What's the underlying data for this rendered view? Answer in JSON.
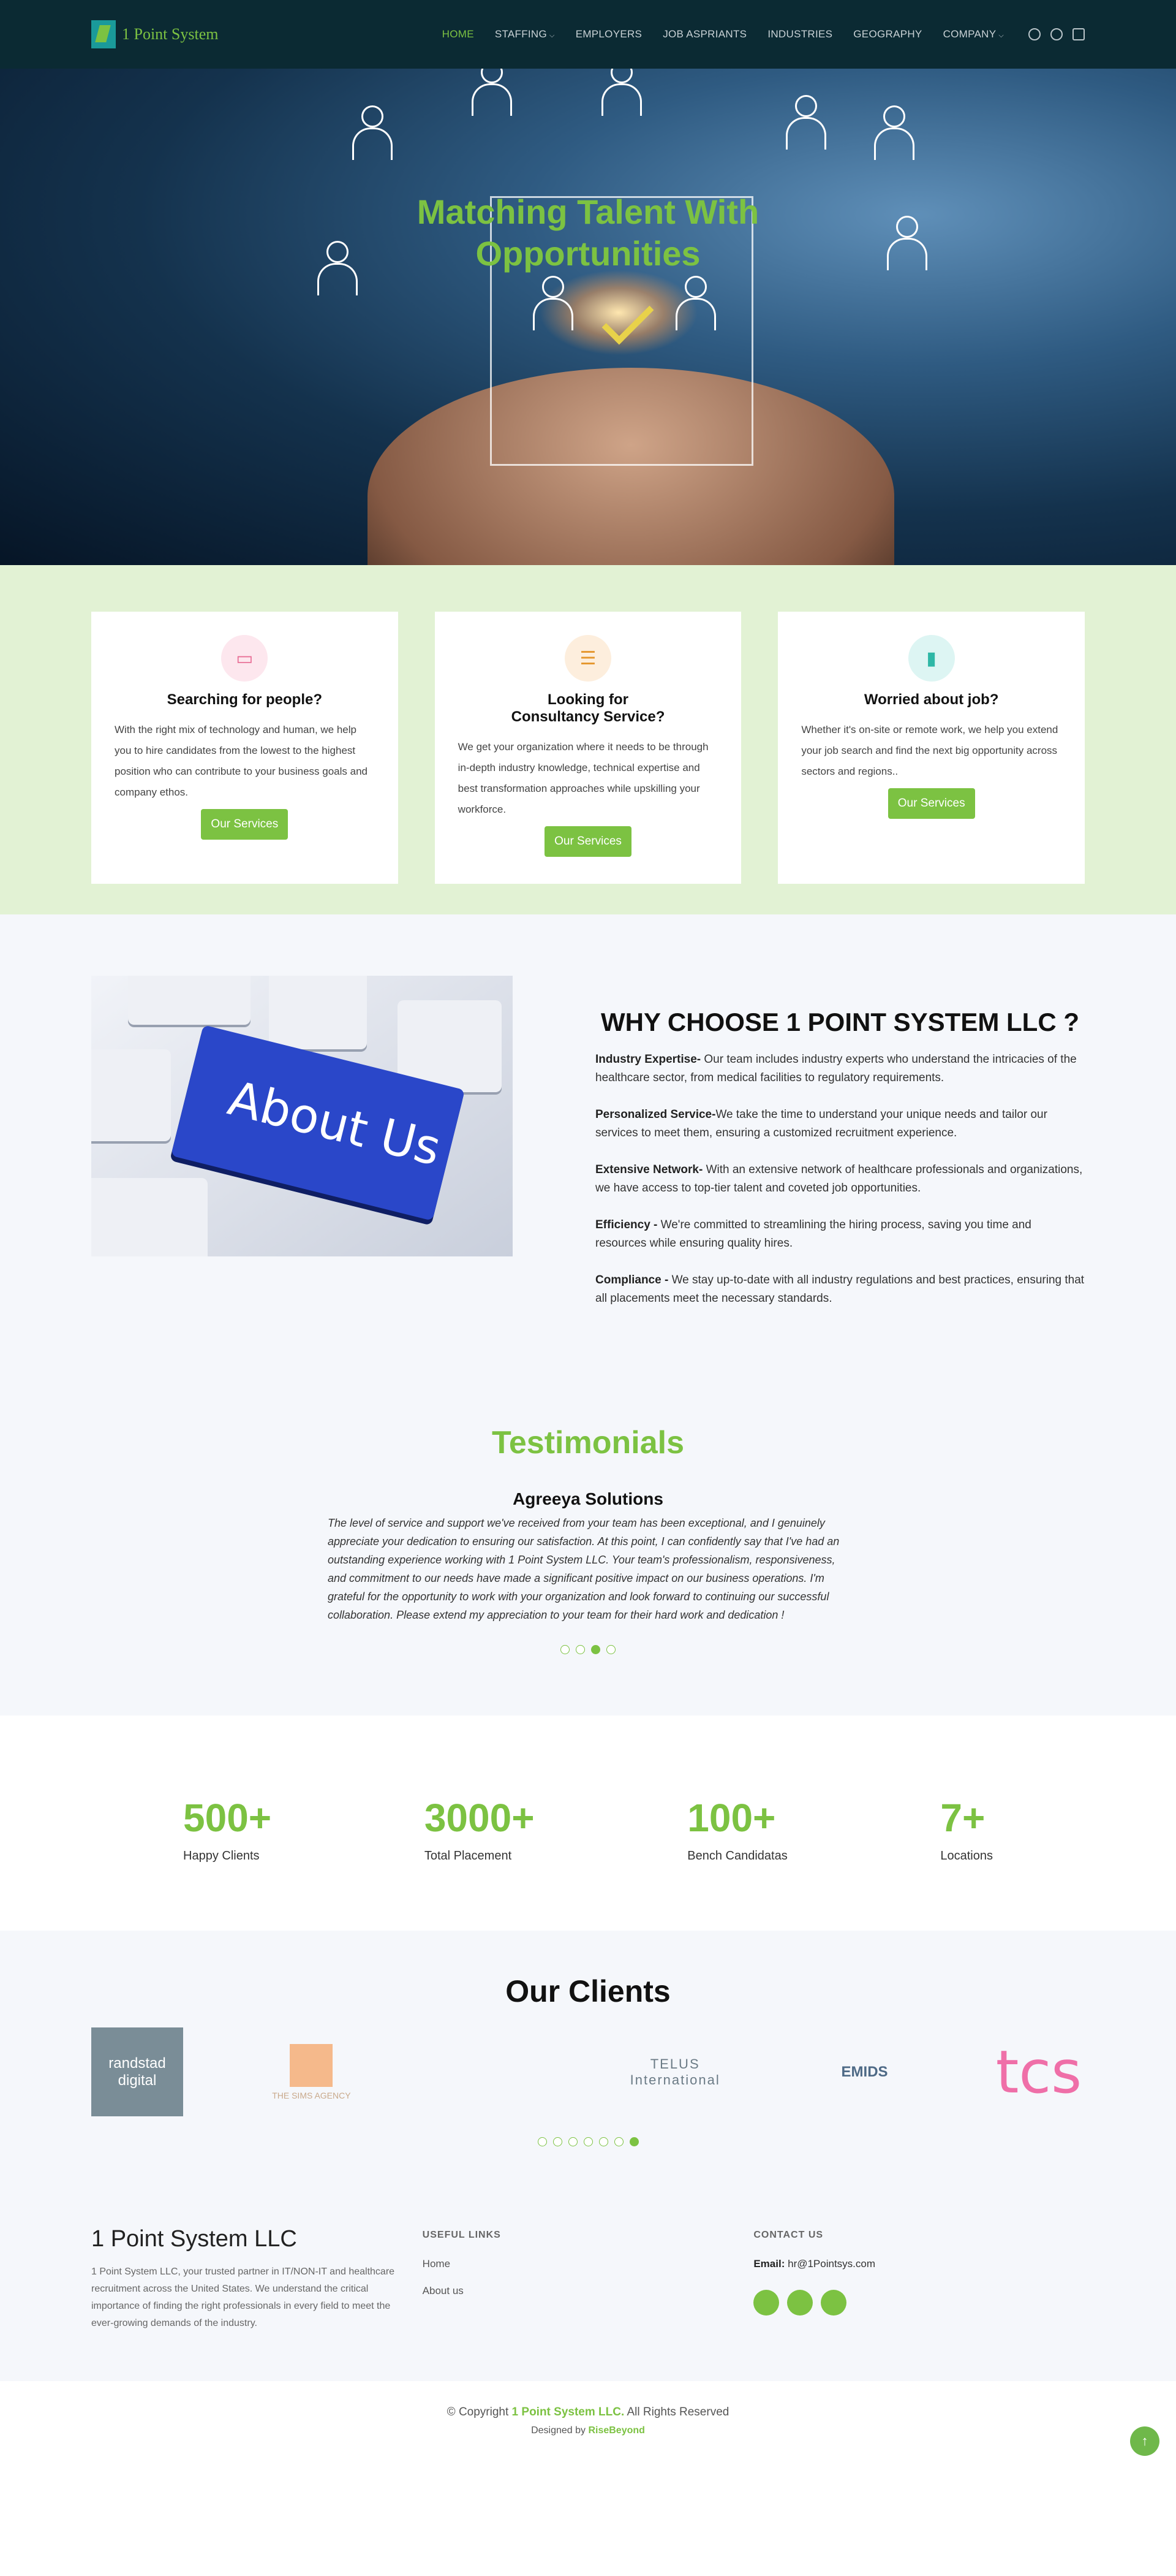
{
  "brand": {
    "name": "1 Point System"
  },
  "nav": {
    "items": [
      {
        "label": "HOME"
      },
      {
        "label": "STAFFING"
      },
      {
        "label": "EMPLOYERS"
      },
      {
        "label": "JOB ASPRIANTS"
      },
      {
        "label": "INDUSTRIES"
      },
      {
        "label": "GEOGRAPHY"
      },
      {
        "label": "COMPANY"
      }
    ]
  },
  "hero": {
    "title": "Matching Talent With Opportunities"
  },
  "cards": [
    {
      "title": "Searching for people?",
      "text": "With the right mix of technology and human, we help you to hire candidates from the lowest to the highest position who can contribute to your business goals and company ethos.",
      "button": "Our Services"
    },
    {
      "title": "Looking for Consultancy Service?",
      "text": "We get your organization where it needs to be through in-depth industry knowledge, technical expertise and best transformation approaches while upskilling your workforce.",
      "button": "Our Services"
    },
    {
      "title": "Worried about job?",
      "text": "Whether it's on-site or remote work, we help you extend your job search and find the next big opportunity across sectors and regions..",
      "button": "Our Services"
    }
  ],
  "about_image_text": "About Us",
  "why": {
    "title": "WHY CHOOSE 1 POINT SYSTEM LLC ?",
    "items": [
      {
        "head": "Industry Expertise-",
        "text": " Our team includes industry experts who understand the intricacies of the healthcare sector, from medical facilities to regulatory requirements."
      },
      {
        "head": "Personalized Service-",
        "text": "We take the time to understand your unique needs and tailor our services to meet them, ensuring a customized recruitment experience."
      },
      {
        "head": "Extensive Network-",
        "text": " With an extensive network of healthcare professionals and organizations, we have access to top-tier talent and coveted job opportunities."
      },
      {
        "head": "Efficiency -",
        "text": " We're committed to streamlining the hiring process, saving you time and resources while ensuring quality hires."
      },
      {
        "head": "Compliance -",
        "text": " We stay up-to-date with all industry regulations and best practices, ensuring that all placements meet the necessary standards."
      }
    ]
  },
  "testimonials": {
    "title": "Testimonials",
    "author": "Agreeya Solutions",
    "quote": "The level of service and support we've received from your team has been exceptional, and I genuinely appreciate your dedication to ensuring our satisfaction. At this point, I can confidently say that I've had an outstanding experience working with 1 Point System LLC. Your team's professionalism, responsiveness, and commitment to our needs have made a significant positive impact on our business operations. I'm grateful for the opportunity to work with your organization and look forward to continuing our successful collaboration. Please extend my appreciation to your team for their hard work and dedication !",
    "dots": 4,
    "active_dot": 2
  },
  "stats": [
    {
      "num": "500+",
      "label": "Happy Clients"
    },
    {
      "num": "3000+",
      "label": "Total Placement"
    },
    {
      "num": "100+",
      "label": "Bench Candidatas"
    },
    {
      "num": "7+",
      "label": "Locations"
    }
  ],
  "clients": {
    "title": "Our Clients",
    "logos": [
      {
        "name": "randstad digital"
      },
      {
        "name": "THE SIMS AGENCY"
      },
      {
        "name": "TELUS International"
      },
      {
        "name": "EMIDS"
      },
      {
        "name": "tcs"
      }
    ],
    "dots": 7,
    "active_dot": 6
  },
  "footer": {
    "company": "1 Point System LLC",
    "desc": "1 Point System LLC, your trusted partner in IT/NON-IT and healthcare recruitment across the United States. We understand the critical importance of finding the right professionals in every field to meet the ever-growing demands of the industry.",
    "links_title": "USEFUL LINKS",
    "links": [
      {
        "label": "Home"
      },
      {
        "label": "About us"
      }
    ],
    "contact_title": "CONTACT US",
    "email_label": "Email:",
    "email": "hr@1Pointsys.com"
  },
  "copyright": {
    "prefix": "© Copyright ",
    "company": "1 Point System LLC.",
    "suffix": " All Rights Reserved",
    "designed_prefix": "Designed by ",
    "designer": "RiseBeyond"
  },
  "colors": {
    "accent": "#7cc242",
    "header": "#0b2a33"
  }
}
